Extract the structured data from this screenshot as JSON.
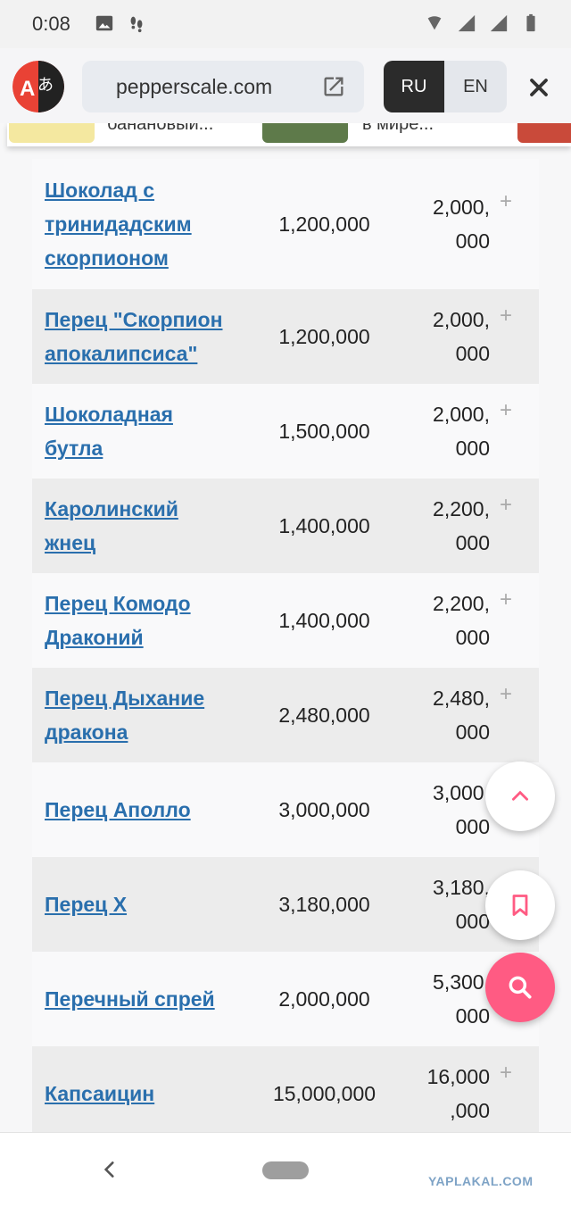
{
  "status_bar": {
    "time": "0:08",
    "icons": [
      "image-icon",
      "footprints-icon",
      "wifi-icon",
      "signal-icon",
      "signal-icon",
      "battery-icon"
    ]
  },
  "translate_bar": {
    "url": "pepperscale.com",
    "lang_ru": "RU",
    "lang_en": "EN"
  },
  "carousel": {
    "items": [
      {
        "text": "банановый..."
      },
      {
        "text": "в мире..."
      }
    ]
  },
  "table": {
    "rows": [
      {
        "name_lines": [
          "Шоколад с",
          "тринидадским",
          "скорпионом"
        ],
        "min": "1,200,000",
        "max_lines": [
          "2,000,",
          "000"
        ]
      },
      {
        "name_lines": [
          "Перец \"Скорпион",
          "апокалипсиса\""
        ],
        "min": "1,200,000",
        "max_lines": [
          "2,000,",
          "000"
        ]
      },
      {
        "name_lines": [
          "Шоколадная",
          "бутла"
        ],
        "min": "1,500,000",
        "max_lines": [
          "2,000,",
          "000"
        ]
      },
      {
        "name_lines": [
          "Каролинский",
          "жнец"
        ],
        "min": "1,400,000",
        "max_lines": [
          "2,200,",
          "000"
        ]
      },
      {
        "name_lines": [
          "Перец Комодо",
          "Драконий"
        ],
        "min": "1,400,000",
        "max_lines": [
          "2,200,",
          "000"
        ]
      },
      {
        "name_lines": [
          "Перец Дыхание",
          "дракона"
        ],
        "min": "2,480,000",
        "max_lines": [
          "2,480,",
          "000"
        ]
      },
      {
        "name_lines": [
          "Перец Аполло"
        ],
        "min": "3,000,000",
        "max_lines": [
          "3,000,",
          "000"
        ]
      },
      {
        "name_lines": [
          "Перец X"
        ],
        "min": "3,180,000",
        "max_lines": [
          "3,180,",
          "000"
        ]
      },
      {
        "name_lines": [
          "Перечный спрей"
        ],
        "min": "2,000,000",
        "max_lines": [
          "5,300,",
          "000"
        ]
      },
      {
        "name_lines": [
          "Капсаицин"
        ],
        "min": "15,000,000",
        "max_lines": [
          "16,000",
          ",000"
        ]
      }
    ],
    "expand_symbol": "+"
  },
  "watermark": "YAPLAKAL.COM",
  "colors": {
    "link": "#2a6fad",
    "fab_accent": "#ff5b83",
    "lang_active_bg": "#2b2b2b"
  }
}
